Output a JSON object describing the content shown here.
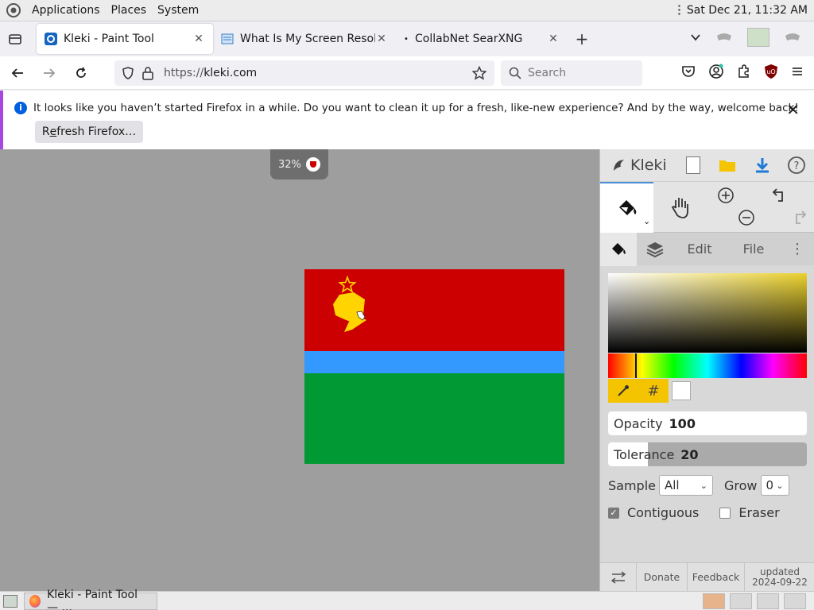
{
  "system": {
    "menu": [
      "Applications",
      "Places",
      "System"
    ],
    "clock": "Sat Dec 21, 11:32 AM"
  },
  "tabs": [
    {
      "label": "Kleki - Paint Tool",
      "active": true
    },
    {
      "label": "What Is My Screen Resolutio",
      "active": false
    },
    {
      "label": "CollabNet SearXNG",
      "active": false
    }
  ],
  "nav": {
    "url_prefix": "https://",
    "url_host": "kleki.com",
    "search_placeholder": "Search"
  },
  "notification": {
    "message": "It looks like you haven’t started Firefox in a while. Do you want to clean it up for a fresh, like-new experience? And by the way, welcome back!",
    "button": "Refresh Firefox…",
    "button_underline": "e"
  },
  "canvas": {
    "zoom": "32%",
    "background": "#9e9e9e",
    "flag_colors": {
      "red": "#cc0000",
      "blue": "#3399ff",
      "green": "#009933",
      "emblem": "#ffd400"
    }
  },
  "panel": {
    "logo": "Kleki",
    "subtabs": {
      "edit": "Edit",
      "file": "File"
    },
    "color_hex": "#ebd12c",
    "opacity_label": "Opacity",
    "opacity_value": "100",
    "opacity_fraction": 1.0,
    "tolerance_label": "Tolerance",
    "tolerance_value": "20",
    "tolerance_fraction": 0.2,
    "sample_label": "Sample",
    "sample_value": "All",
    "grow_label": "Grow",
    "grow_value": "0",
    "contiguous_label": "Contiguous",
    "contiguous_checked": true,
    "eraser_label": "Eraser",
    "eraser_checked": false,
    "footer": {
      "donate": "Donate",
      "feedback": "Feedback",
      "updated_label": "updated",
      "updated_date": "2024-09-22"
    }
  },
  "taskbar": {
    "task_label": "Kleki - Paint Tool — ..."
  }
}
